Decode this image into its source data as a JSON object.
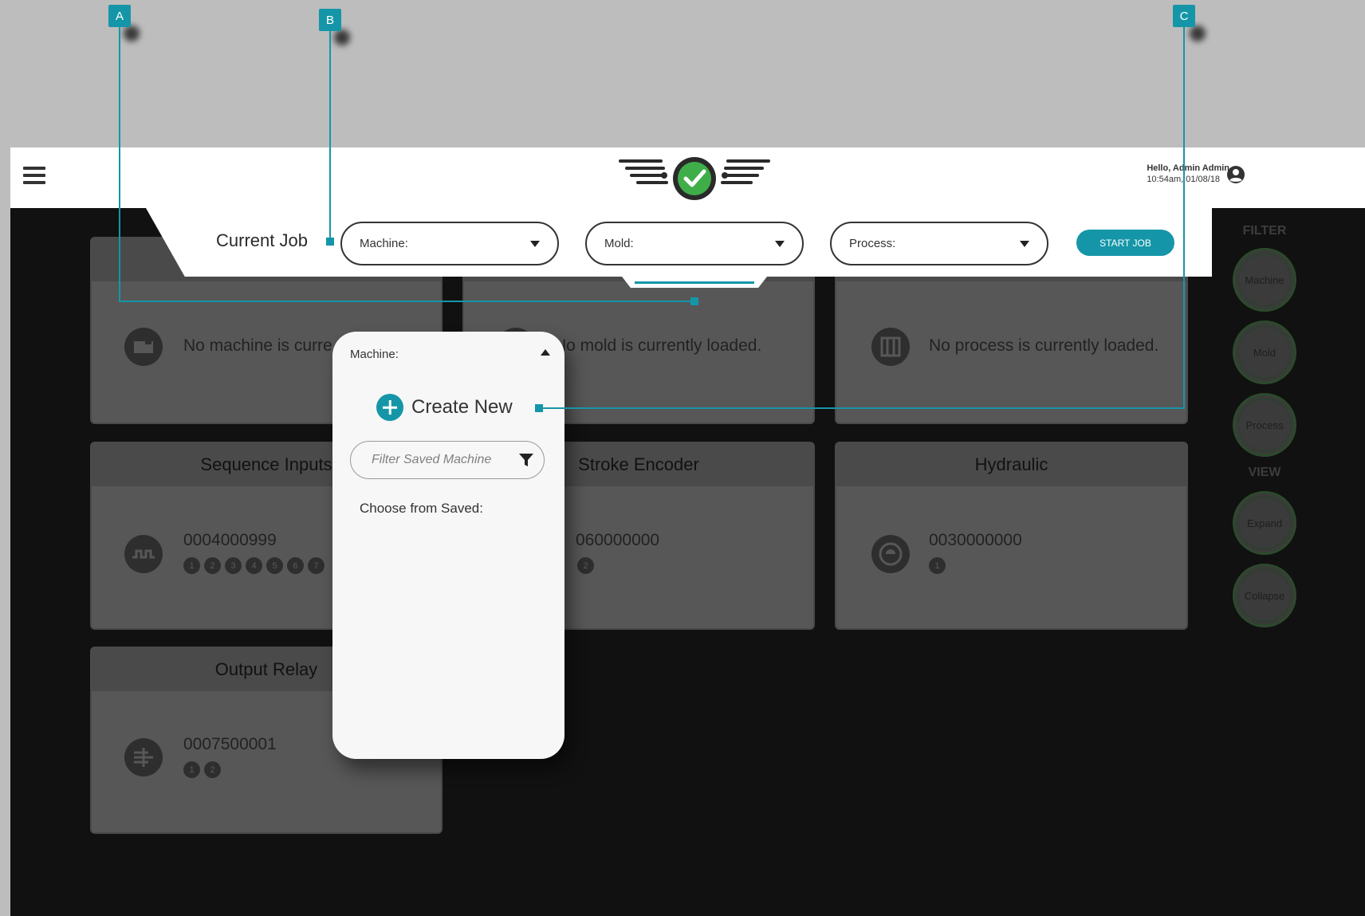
{
  "header": {
    "greeting": "Hello, Admin Admin",
    "timestamp": "10:54am, 01/08/18",
    "icons": {
      "menu": "hamburger-icon",
      "logo": "wings-check-logo",
      "user": "user-circle-icon"
    }
  },
  "job_bar": {
    "title": "Current Job",
    "machine_label": "Machine:",
    "mold_label": "Mold:",
    "process_label": "Process:",
    "start_label": "START JOB"
  },
  "cards": {
    "machine": {
      "text": "No machine is curre"
    },
    "mold": {
      "text": "No mold is currently loaded."
    },
    "process": {
      "text": "No process is currently loaded."
    },
    "sequence": {
      "title": "Sequence Inputs",
      "id": "0004000999",
      "dots": [
        "1",
        "2",
        "3",
        "4",
        "5",
        "6",
        "7"
      ]
    },
    "stroke": {
      "title": "Stroke Encoder",
      "id": "060000000",
      "dots": [
        "2"
      ]
    },
    "hydraulic": {
      "title": "Hydraulic",
      "id": "0030000000",
      "dots": [
        "1"
      ]
    },
    "relay": {
      "title": "Output Relay",
      "id": "0007500001",
      "dots": [
        "1",
        "2"
      ]
    }
  },
  "sidebar": {
    "filter_heading": "FILTER",
    "filter_buttons": [
      "Machine",
      "Mold",
      "Process"
    ],
    "view_heading": "VIEW",
    "view_buttons": [
      "Expand",
      "Collapse"
    ]
  },
  "dropdown": {
    "title": "Machine:",
    "create_label": "Create New",
    "filter_placeholder": "Filter Saved Machine",
    "choose_label": "Choose from Saved:"
  },
  "callouts": {
    "a": "A",
    "b": "B",
    "c": "C"
  },
  "colors": {
    "accent": "#1596a8",
    "background": "#111111",
    "card": "#575757"
  }
}
